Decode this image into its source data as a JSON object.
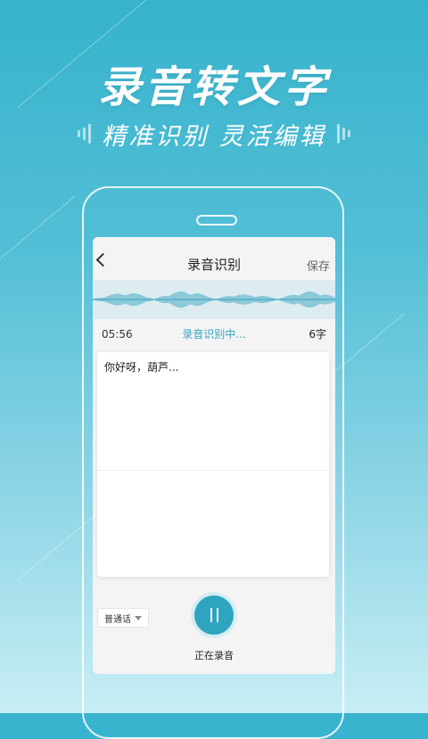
{
  "hero": {
    "title": "录音转文字",
    "subtitle": "精准识别 灵活编辑"
  },
  "screen": {
    "title": "录音识别",
    "save_label": "保存",
    "back_icon": "chevron-left-icon",
    "elapsed_time": "05:56",
    "recognizing_text": "录音识别中...",
    "char_count": "6字",
    "transcript": "你好呀，葫芦...",
    "language": "普通话",
    "record_status": "正在录音",
    "record_button_icon": "pause-icon"
  },
  "colors": {
    "background_top": "#37b3cd",
    "accent": "#2ea4c1",
    "waveform": "#3aa4c0",
    "wave_strip_bg": "#dcecf1"
  }
}
